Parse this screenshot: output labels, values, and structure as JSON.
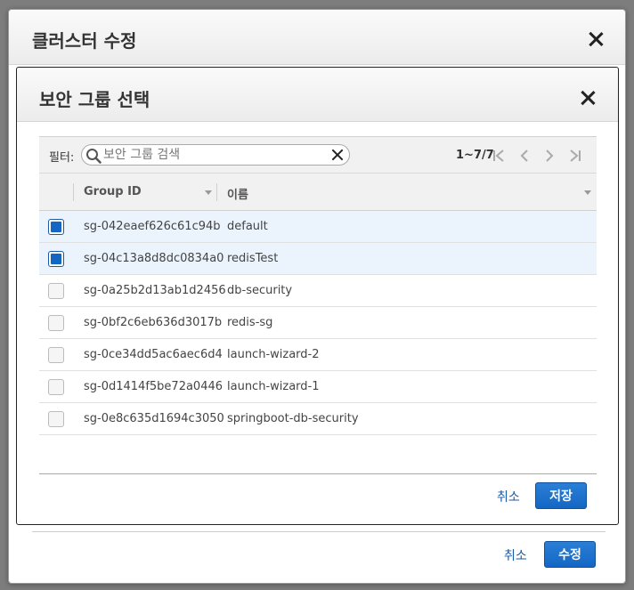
{
  "outer_modal": {
    "title": "클러스터 수정",
    "cancel_label": "취소",
    "submit_label": "수정"
  },
  "inner_modal": {
    "title": "보안 그룹 선택",
    "filter_label": "필터:",
    "search_placeholder": "보안 그룹 검색",
    "search_value": "",
    "pager_text": "1~7/7",
    "cancel_label": "취소",
    "save_label": "저장"
  },
  "table": {
    "columns": [
      "Group ID",
      "이름"
    ],
    "rows": [
      {
        "id": "sg-042eaef626c61c94b",
        "name": "default",
        "checked": true
      },
      {
        "id": "sg-04c13a8d8dc0834a0",
        "name": "redisTest",
        "checked": true
      },
      {
        "id": "sg-0a25b2d13ab1d2456",
        "name": "db-security",
        "checked": false
      },
      {
        "id": "sg-0bf2c6eb636d3017b",
        "name": "redis-sg",
        "checked": false
      },
      {
        "id": "sg-0ce34dd5ac6aec6d4",
        "name": "launch-wizard-2",
        "checked": false
      },
      {
        "id": "sg-0d1414f5be72a0446",
        "name": "launch-wizard-1",
        "checked": false
      },
      {
        "id": "sg-0e8c635d1694c3050",
        "name": "springboot-db-security",
        "checked": false
      }
    ]
  },
  "icons": {
    "search": "search-icon",
    "clear": "close-icon",
    "pager_first": "first-page-icon",
    "pager_prev": "prev-page-icon",
    "pager_next": "next-page-icon",
    "pager_last": "last-page-icon"
  },
  "colors": {
    "primary_button": "#1466c3",
    "link": "#1a5aa6",
    "selected_row": "#ebf3fc"
  }
}
